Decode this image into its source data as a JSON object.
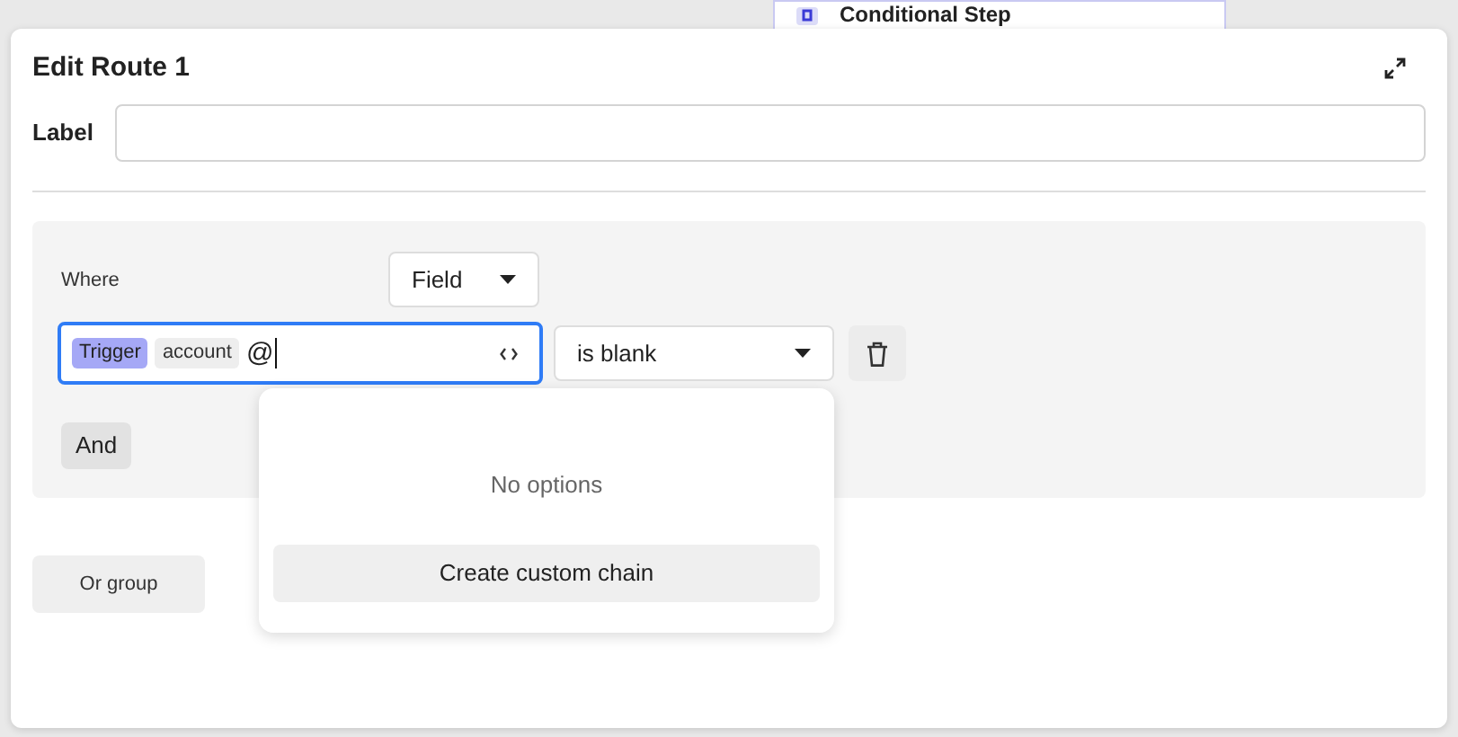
{
  "background_node": {
    "title": "Conditional Step"
  },
  "dialog": {
    "title": "Edit Route 1",
    "label_field": {
      "label": "Label"
    }
  },
  "condition_group": {
    "where_label": "Where",
    "source_select": {
      "value": "Field"
    },
    "condition": {
      "tokens": [
        {
          "text": "Trigger",
          "kind": "source"
        },
        {
          "text": "account",
          "kind": "path"
        }
      ],
      "typed": "@",
      "focused": true,
      "operator": "is blank"
    },
    "and_button": "And"
  },
  "dropdown": {
    "empty_text": "No options",
    "action": "Create custom chain"
  },
  "or_group_button": "Or group"
}
